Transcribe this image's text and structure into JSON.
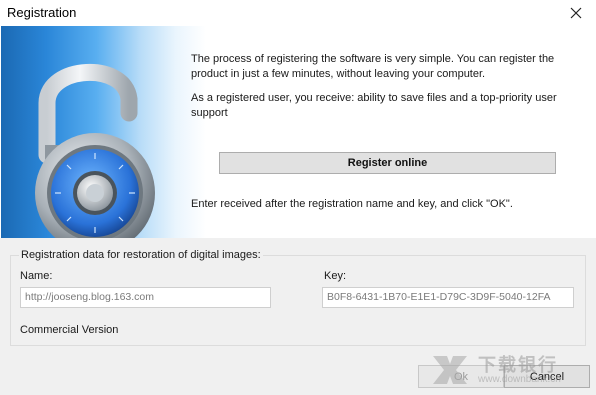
{
  "window": {
    "title": "Registration",
    "close_icon": "close-icon"
  },
  "banner": {
    "icon": "padlock-icon",
    "description_1": "The process of registering the software is very simple. You can register the product in just a few minutes, without leaving your computer.",
    "description_2": "As a registered user, you receive: ability to save files and a top-priority user support",
    "register_label": "Register online",
    "instruction": "Enter received after the registration name and key, and click \"OK\"."
  },
  "registration": {
    "group_title": "Registration data for restoration of digital images:",
    "name_label": "Name:",
    "name_value": "http://jooseng.blog.163.com",
    "key_label": "Key:",
    "key_value": "B0F8-6431-1B70-E1E1-D79C-3D9F-5040-12FA",
    "edition": "Commercial Version"
  },
  "buttons": {
    "ok_label": "Ok",
    "cancel_label": "Cancel"
  },
  "watermark": {
    "title": "下载银行",
    "url": "www.downbank.cn"
  }
}
